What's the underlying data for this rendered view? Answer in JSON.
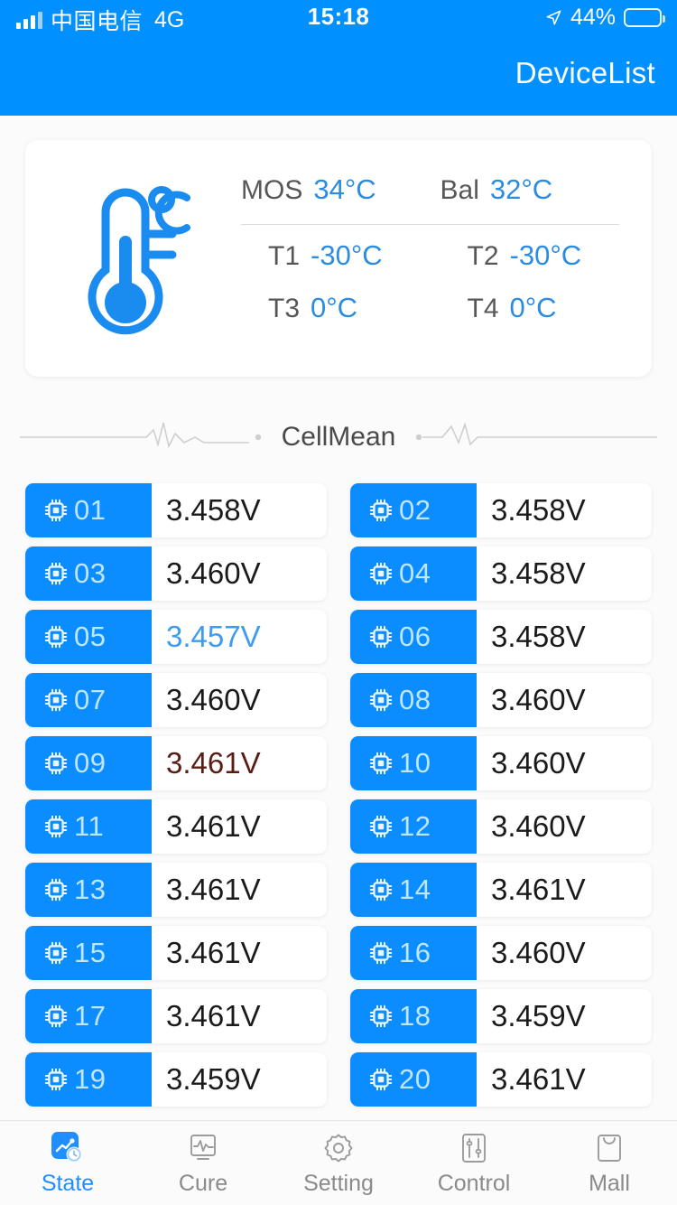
{
  "statusbar": {
    "carrier": "中国电信",
    "network": "4G",
    "time": "15:18",
    "battery_pct": "44%",
    "battery_level": 44,
    "signal_icon": "signal-bars-icon",
    "location_icon": "location-arrow-icon",
    "battery_icon": "battery-icon"
  },
  "header": {
    "title": "DeviceList",
    "bg_color": "#0090ff"
  },
  "temperature": {
    "icon": "thermometer-celsius-icon",
    "top": [
      {
        "label": "MOS",
        "value": "34°C"
      },
      {
        "label": "Bal",
        "value": "32°C"
      }
    ],
    "bottom": [
      {
        "label": "T1",
        "value": "-30°C"
      },
      {
        "label": "T2",
        "value": "-30°C"
      },
      {
        "label": "T3",
        "value": "0°C"
      },
      {
        "label": "T4",
        "value": "0°C"
      }
    ]
  },
  "divider": {
    "label": "CellMean",
    "icon": "heartbeat-line-icon"
  },
  "cells": {
    "icon": "chip-icon",
    "items": [
      {
        "id": "01",
        "value": "3.458V",
        "state": "normal"
      },
      {
        "id": "02",
        "value": "3.458V",
        "state": "normal"
      },
      {
        "id": "03",
        "value": "3.460V",
        "state": "normal"
      },
      {
        "id": "04",
        "value": "3.458V",
        "state": "normal"
      },
      {
        "id": "05",
        "value": "3.457V",
        "state": "low"
      },
      {
        "id": "06",
        "value": "3.458V",
        "state": "normal"
      },
      {
        "id": "07",
        "value": "3.460V",
        "state": "normal"
      },
      {
        "id": "08",
        "value": "3.460V",
        "state": "normal"
      },
      {
        "id": "09",
        "value": "3.461V",
        "state": "high"
      },
      {
        "id": "10",
        "value": "3.460V",
        "state": "normal"
      },
      {
        "id": "11",
        "value": "3.461V",
        "state": "normal"
      },
      {
        "id": "12",
        "value": "3.460V",
        "state": "normal"
      },
      {
        "id": "13",
        "value": "3.461V",
        "state": "normal"
      },
      {
        "id": "14",
        "value": "3.461V",
        "state": "normal"
      },
      {
        "id": "15",
        "value": "3.461V",
        "state": "normal"
      },
      {
        "id": "16",
        "value": "3.460V",
        "state": "normal"
      },
      {
        "id": "17",
        "value": "3.461V",
        "state": "normal"
      },
      {
        "id": "18",
        "value": "3.459V",
        "state": "normal"
      },
      {
        "id": "19",
        "value": "3.459V",
        "state": "normal"
      },
      {
        "id": "20",
        "value": "3.461V",
        "state": "normal"
      }
    ]
  },
  "tabbar": {
    "accent_color": "#1f8fff",
    "items": [
      {
        "label": "State",
        "icon": "state-chart-clock-icon",
        "active": true
      },
      {
        "label": "Cure",
        "icon": "monitor-waveform-icon",
        "active": false
      },
      {
        "label": "Setting",
        "icon": "gear-icon",
        "active": false
      },
      {
        "label": "Control",
        "icon": "sliders-icon",
        "active": false
      },
      {
        "label": "Mall",
        "icon": "shopping-bag-icon",
        "active": false
      }
    ]
  }
}
